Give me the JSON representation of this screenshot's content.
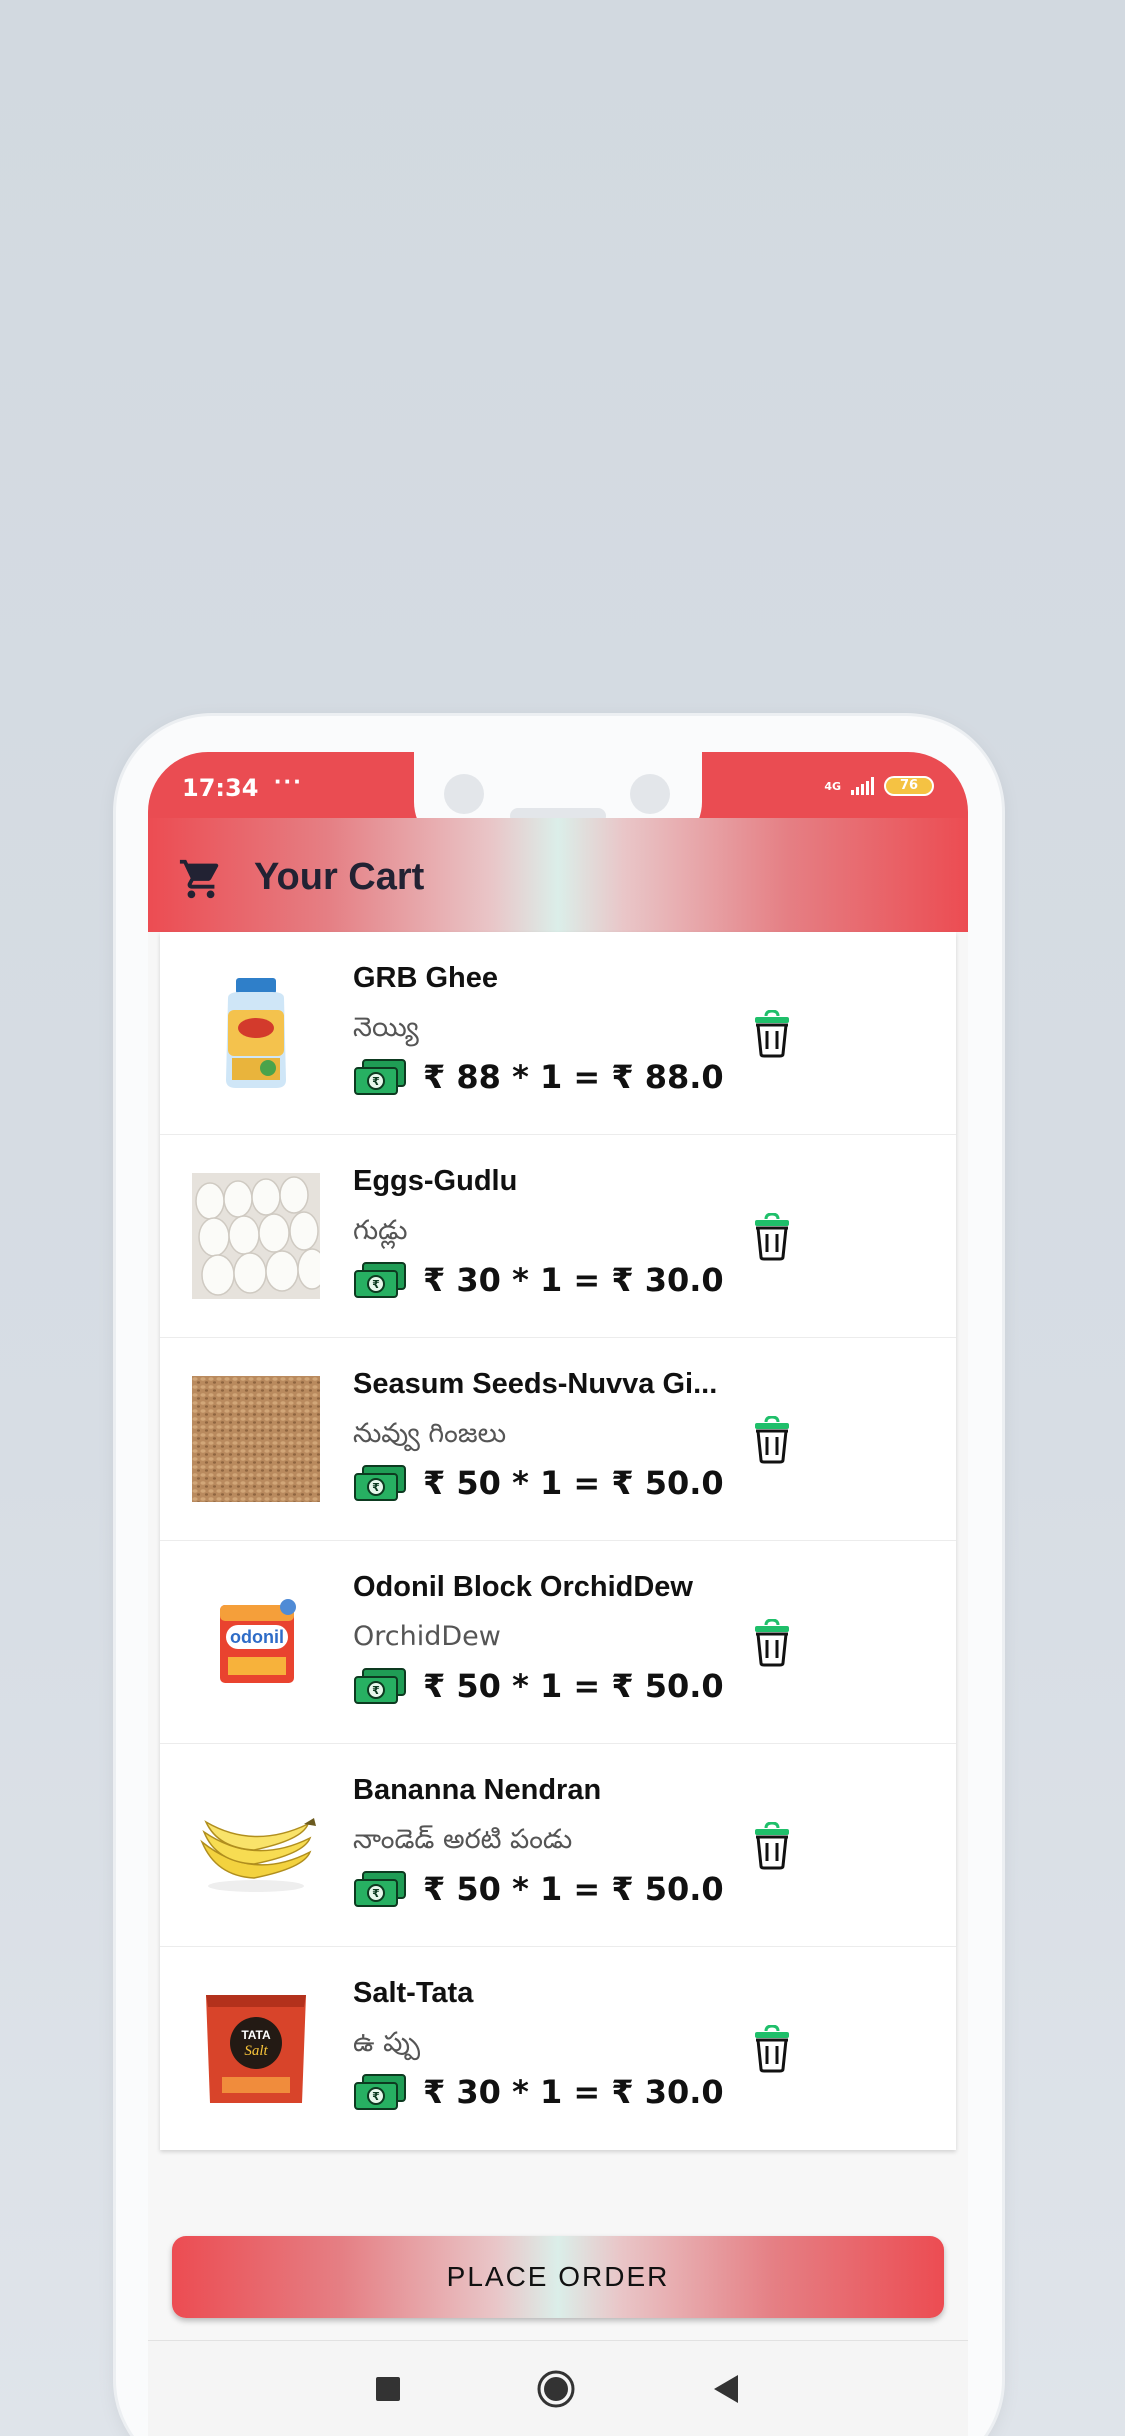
{
  "status_bar": {
    "time": "17:34",
    "dots": "···",
    "network": "4G",
    "battery": "76"
  },
  "header": {
    "title": "Your Cart",
    "icon": "cart-icon"
  },
  "cart": {
    "items": [
      {
        "name": "GRB Ghee",
        "subtitle": "నెయ్యి",
        "price": "₹ 88 * 1 = ₹ 88.0",
        "image": "ghee-jar"
      },
      {
        "name": "Eggs-Gudlu",
        "subtitle": "గుడ్లు",
        "price": "₹ 30 * 1 = ₹ 30.0",
        "image": "egg-tray"
      },
      {
        "name": "Seasum Seeds-Nuvva Gi...",
        "subtitle": "నువ్వు గింజలు",
        "price": "₹ 50 * 1 = ₹ 50.0",
        "image": "sesame-seeds"
      },
      {
        "name": "Odonil Block OrchidDew",
        "subtitle": "OrchidDew",
        "price": "₹ 50 * 1 = ₹ 50.0",
        "image": "odonil-pack"
      },
      {
        "name": "Bananna Nendran",
        "subtitle": "నాండెడ్ అరటి పండు",
        "price": "₹ 50 * 1 = ₹ 50.0",
        "image": "banana-bunch"
      },
      {
        "name": "Salt-Tata",
        "subtitle": "ఉ ప్పు",
        "price": "₹ 30 * 1 = ₹ 30.0",
        "image": "tata-salt-pack"
      }
    ]
  },
  "actions": {
    "place_order": "PLACE ORDER"
  },
  "colors": {
    "accent": "#ea4c52",
    "delete_lid": "#1fbf6a",
    "money_green": "#1f9d55"
  }
}
